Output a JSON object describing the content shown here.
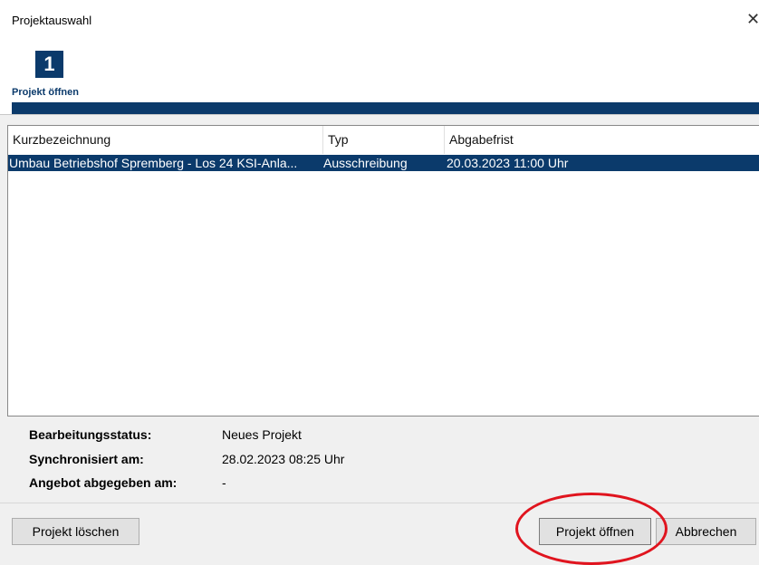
{
  "window": {
    "title": "Projektauswahl",
    "close_icon": "close-icon"
  },
  "wizard": {
    "step_number": "1",
    "step_label": "Projekt öffnen",
    "progress": 1.0
  },
  "table": {
    "columns": [
      "Kurzbezeichnung",
      "Typ",
      "Abgabefrist"
    ],
    "rows": [
      {
        "kurzbezeichnung": "Umbau Betriebshof Spremberg - Los 24 KSI-Anla...",
        "typ": "Ausschreibung",
        "abgabefrist": "20.03.2023 11:00 Uhr",
        "selected": true
      }
    ]
  },
  "status": {
    "bearbeitungsstatus_label": "Bearbeitungsstatus:",
    "bearbeitungsstatus_value": "Neues Projekt",
    "synchronisiert_label": "Synchronisiert am:",
    "synchronisiert_value": "28.02.2023 08:25 Uhr",
    "angebot_label": "Angebot abgegeben am:",
    "angebot_value": "-"
  },
  "buttons": {
    "delete_label": "Projekt löschen",
    "open_label": "Projekt öffnen",
    "cancel_label": "Abbrechen"
  },
  "colors": {
    "accent": "#0b3a6b",
    "highlight": "#e0141e",
    "background": "#f0f0f0"
  }
}
